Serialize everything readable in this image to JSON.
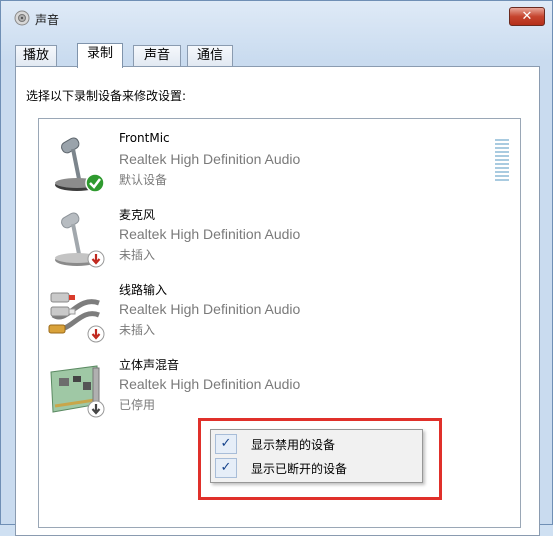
{
  "window": {
    "title": "声音",
    "close_glyph": "✕"
  },
  "tabs": [
    {
      "label": "播放",
      "active": false
    },
    {
      "label": "录制",
      "active": true
    },
    {
      "label": "声音",
      "active": false
    },
    {
      "label": "通信",
      "active": false
    }
  ],
  "prompt": "选择以下录制设备来修改设置:",
  "devices": [
    {
      "name": "FrontMic",
      "driver": "Realtek High Definition Audio",
      "status": "默认设备",
      "icon": "microphone-icon",
      "badge": "check-badge-icon"
    },
    {
      "name": "麦克风",
      "driver": "Realtek High Definition Audio",
      "status": "未插入",
      "icon": "microphone-icon",
      "badge": "unplugged-badge-icon"
    },
    {
      "name": "线路输入",
      "driver": "Realtek High Definition Audio",
      "status": "未插入",
      "icon": "rca-cable-icon",
      "badge": "unplugged-badge-icon"
    },
    {
      "name": "立体声混音",
      "driver": "Realtek High Definition Audio",
      "status": "已停用",
      "icon": "sound-card-icon",
      "badge": "disabled-badge-icon"
    }
  ],
  "context_menu": {
    "items": [
      {
        "label": "显示禁用的设备",
        "checked": true,
        "check_glyph": "✓"
      },
      {
        "label": "显示已断开的设备",
        "checked": true,
        "check_glyph": "✓"
      }
    ]
  },
  "colors": {
    "highlight": "#e0302a",
    "check": "#15428b",
    "badge_ok": "#2f9a2f",
    "badge_unplugged": "#c0281e"
  }
}
